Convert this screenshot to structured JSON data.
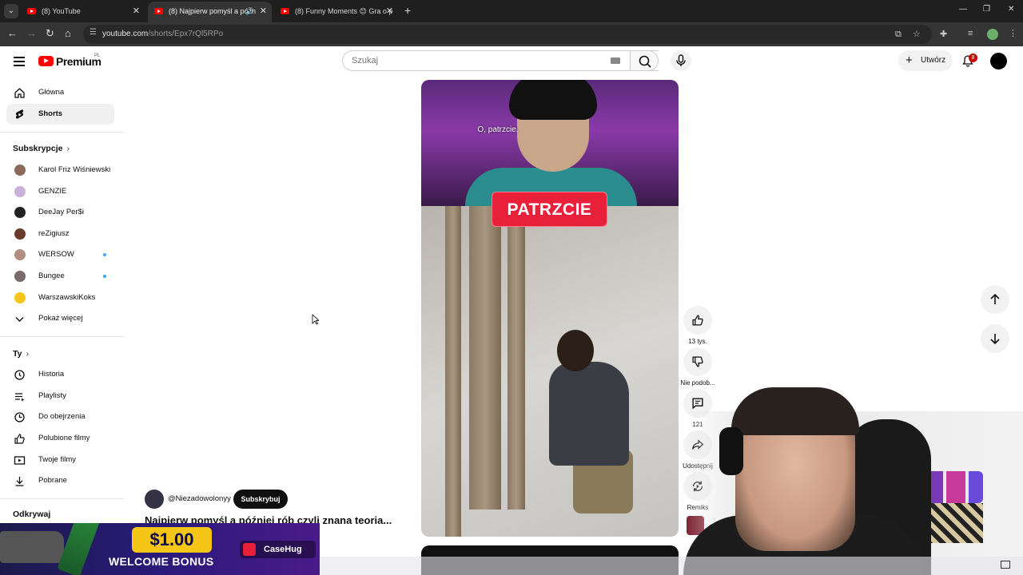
{
  "browser": {
    "tabs": [
      {
        "title": "(8) YouTube",
        "active": false
      },
      {
        "title": "(8) Najpierw pomyśl a późn",
        "active": true
      },
      {
        "title": "(8) Funny Moments 😊 Gra o p",
        "active": false
      }
    ],
    "url_host": "youtube.com",
    "url_path": "/shorts/Epx7rQl5RPo"
  },
  "header": {
    "logo_text": "Premium",
    "country_code": "PL",
    "search_placeholder": "Szukaj",
    "create_label": "Utwórz",
    "notification_count": "8"
  },
  "sidebar": {
    "main": [
      {
        "label": "Główna",
        "icon": "home-icon"
      },
      {
        "label": "Shorts",
        "icon": "shorts-icon",
        "active": true
      }
    ],
    "subscriptions_heading": "Subskrypcje",
    "subscriptions": [
      {
        "label": "Karol Friz Wiśniewski",
        "color": "#8a6a5a",
        "new": false
      },
      {
        "label": "GENZIE",
        "color": "#c8b0d8",
        "new": false
      },
      {
        "label": "DeeJay Per$i",
        "color": "#222222",
        "new": false
      },
      {
        "label": "reZigiusz",
        "color": "#6a3a2a",
        "new": false
      },
      {
        "label": "WERSOW",
        "color": "#b09080",
        "new": true
      },
      {
        "label": "Bungee",
        "color": "#7a6a6a",
        "new": true
      },
      {
        "label": "WarszawskiKoks",
        "color": "#f5c518",
        "new": false
      }
    ],
    "show_more": "Pokaż więcej",
    "you_heading": "Ty",
    "you_items": [
      {
        "label": "Historia",
        "icon": "history-icon"
      },
      {
        "label": "Playlisty",
        "icon": "playlist-icon"
      },
      {
        "label": "Do obejrzenia",
        "icon": "watch-later-icon"
      },
      {
        "label": "Polubione filmy",
        "icon": "thumbs-up-icon"
      },
      {
        "label": "Twoje filmy",
        "icon": "your-videos-icon"
      },
      {
        "label": "Pobrane",
        "icon": "download-icon"
      }
    ],
    "explore_heading": "Odkrywaj"
  },
  "short": {
    "subtitle": "O, patrzcie.",
    "caption": "PATRZCIE",
    "channel": "@Niezadowolonyy",
    "subscribe_label": "Subskrybuj",
    "title": "Najpierw pomyśl a później rób czyli znana teoria..."
  },
  "actions": {
    "likes": "13 tys.",
    "dislike": "Nie podob...",
    "comments": "121",
    "share": "Udostępnij",
    "remix": "Remiks"
  },
  "ad": {
    "amount": "$1.00",
    "bonus": "WELCOME BONUS",
    "brand": "CaseHug"
  }
}
